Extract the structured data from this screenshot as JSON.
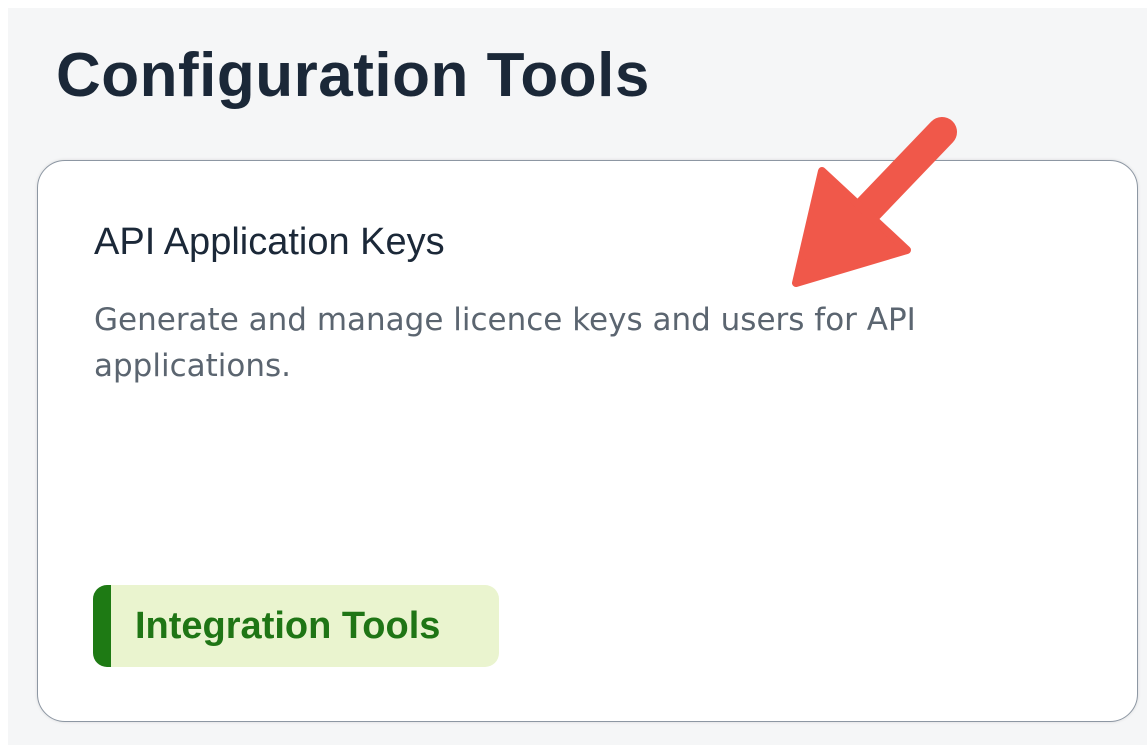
{
  "page": {
    "title": "Configuration Tools"
  },
  "card": {
    "title": "API Application Keys",
    "description": "Generate and manage licence keys and users for API applications.",
    "tag_label": "Integration Tools"
  },
  "annotation": {
    "icon": "arrow-pointer",
    "color": "#f0584a"
  },
  "colors": {
    "background": "#f5f6f7",
    "title_text": "#1b2838",
    "description_text": "#5b6570",
    "tag_background": "#eaf4cf",
    "tag_accent": "#1e7a14",
    "card_border": "#8d97a3"
  }
}
